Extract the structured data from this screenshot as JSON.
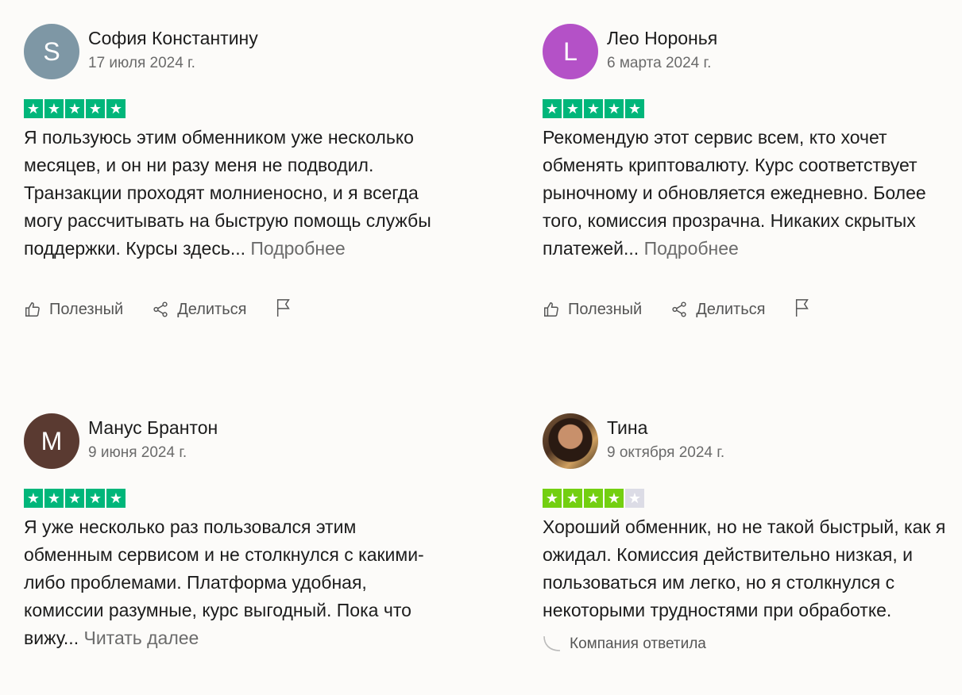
{
  "labels": {
    "helpful": "Полезный",
    "share": "Делиться",
    "company_replied": "Компания ответила"
  },
  "colors": {
    "star_green": "#00b67a",
    "star_lightgreen": "#73cf11",
    "star_empty": "#dcdce6"
  },
  "reviews": [
    {
      "name": "София Константину",
      "initial": "S",
      "avatar_color": "#7e97a5",
      "date": "17 июля 2024 г.",
      "rating": 5,
      "text": "Я пользуюсь этим обменником уже несколько месяцев, и он ни разу меня не подводил. Транзакции проходят молниеносно, и я всегда могу рассчитывать на быструю помощь службы поддержки. Курсы здесь...",
      "more": "Подробнее"
    },
    {
      "name": "Лео Норонья",
      "initial": "L",
      "avatar_color": "#b451c7",
      "date": "6 марта 2024 г.",
      "rating": 5,
      "text": "Рекомендую этот сервис всем, кто хочет обменять криптовалюту. Курс соответствует рыночному и обновляется ежедневно. Более того, комиссия прозрачна. Никаких скрытых платежей...",
      "more": "Подробнее"
    },
    {
      "name": "Манус Брантон",
      "initial": "M",
      "avatar_color": "#5a3a31",
      "date": "9 июня 2024 г.",
      "rating": 5,
      "text": "Я уже несколько раз пользовался этим обменным сервисом и не столкнулся с какими-либо проблемами. Платформа удобная, комиссии разумные, курс выгодный. Пока что вижу...",
      "more": "Читать далее"
    },
    {
      "name": "Тина",
      "initial": "",
      "avatar_color": "#5a3a22",
      "date": "9 октября 2024 г.",
      "rating": 4,
      "text": "Хороший обменник, но не такой быстрый, как я ожидал. Комиссия действительно низкая, и пользоваться им легко, но я столкнулся с некоторыми трудностями при обработке.",
      "more": ""
    }
  ]
}
